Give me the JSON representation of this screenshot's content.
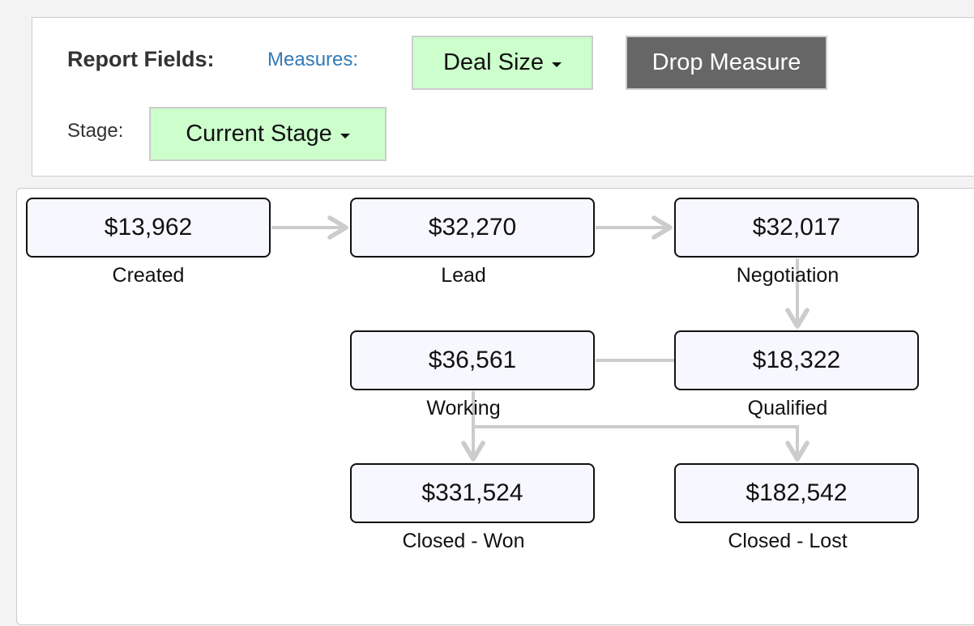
{
  "fields": {
    "report_label": "Report Fields:",
    "measures_label": "Measures:",
    "measure_value": "Deal Size",
    "drop_label": "Drop Measure",
    "stage_label": "Stage:",
    "stage_value": "Current Stage"
  },
  "colors": {
    "pill_green": "#ccffcc",
    "drop_button": "#666666",
    "measures_link": "#337ab7",
    "node_fill": "#f7f7ff",
    "connector": "#cccccc"
  },
  "diagram": {
    "nodes": [
      {
        "id": "created",
        "value": "$13,962",
        "label": "Created"
      },
      {
        "id": "lead",
        "value": "$32,270",
        "label": "Lead"
      },
      {
        "id": "negotiation",
        "value": "$32,017",
        "label": "Negotiation"
      },
      {
        "id": "working",
        "value": "$36,561",
        "label": "Working"
      },
      {
        "id": "qualified",
        "value": "$18,322",
        "label": "Qualified"
      },
      {
        "id": "closed_won",
        "value": "$331,524",
        "label": "Closed - Won"
      },
      {
        "id": "closed_lost",
        "value": "$182,542",
        "label": "Closed - Lost"
      }
    ],
    "edges": [
      {
        "from": "created",
        "to": "lead"
      },
      {
        "from": "lead",
        "to": "negotiation"
      },
      {
        "from": "negotiation",
        "to": "qualified"
      },
      {
        "from": "qualified",
        "to": "working"
      },
      {
        "from": "working",
        "to": "closed_won"
      },
      {
        "from": "working",
        "to": "closed_lost"
      }
    ]
  }
}
